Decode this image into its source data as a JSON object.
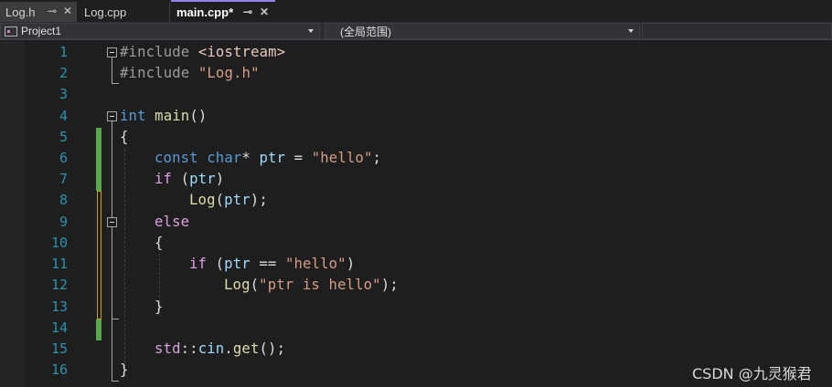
{
  "tabs": [
    {
      "label": "Log.h",
      "active": false,
      "pin": "⊸",
      "close": "✕"
    },
    {
      "label": "Log.cpp",
      "active": false
    },
    {
      "label": "main.cpp*",
      "active": true,
      "pin": "⊸",
      "close": "✕"
    }
  ],
  "navbar": {
    "project": "Project1",
    "scope": "(全局范围)"
  },
  "editor": {
    "line_numbers": [
      "1",
      "2",
      "3",
      "4",
      "5",
      "6",
      "7",
      "8",
      "9",
      "10",
      "11",
      "12",
      "13",
      "14",
      "15",
      "16"
    ]
  },
  "code": {
    "l1": {
      "a": "#include ",
      "b": "<iostream>"
    },
    "l2": {
      "a": "#include ",
      "b": "\"Log.h\""
    },
    "l4": {
      "a": "int",
      "b": " ",
      "c": "main",
      "d": "()"
    },
    "l5": {
      "a": "{"
    },
    "l6": {
      "a": "const",
      "b": " ",
      "c": "char",
      "d": "* ",
      "e": "ptr",
      "f": " = ",
      "g": "\"hello\"",
      "h": ";"
    },
    "l7": {
      "a": "if",
      "b": " (",
      "c": "ptr",
      "d": ")"
    },
    "l8": {
      "a": "Log",
      "b": "(",
      "c": "ptr",
      "d": ");"
    },
    "l9": {
      "a": "else"
    },
    "l10": {
      "a": "{"
    },
    "l11": {
      "a": "if",
      "b": " (",
      "c": "ptr",
      "d": " == ",
      "e": "\"hello\"",
      "f": ")"
    },
    "l12": {
      "a": "Log",
      "b": "(",
      "c": "\"ptr is hello\"",
      "d": ");"
    },
    "l13": {
      "a": "}"
    },
    "l15": {
      "a": "std",
      "b": "::",
      "c": "cin",
      "d": ".",
      "e": "get",
      "f": "();"
    },
    "l16": {
      "a": "}"
    }
  },
  "watermark": "CSDN @九灵猴君",
  "colors": {
    "background": "#1e1e1e",
    "keyword": "#569cd6",
    "string": "#d69d85",
    "function": "#dcdcaa",
    "variable": "#9cdcfe",
    "line_number": "#2b91af",
    "change_saved": "#57a64a",
    "change_unsaved": "#c8a219"
  }
}
